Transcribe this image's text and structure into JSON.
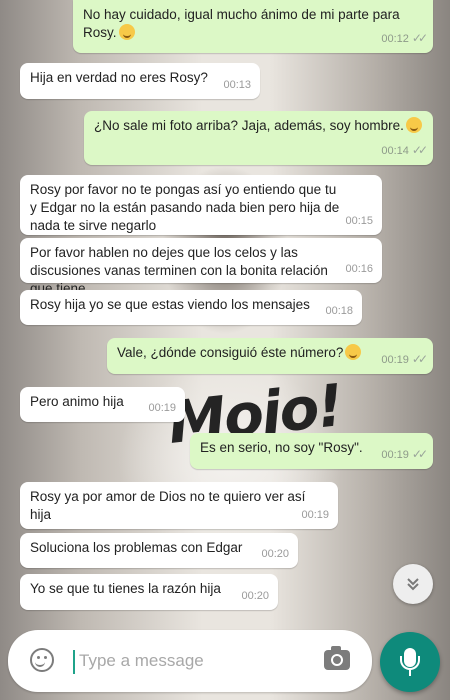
{
  "messages": [
    {
      "dir": "out",
      "text": "No hay cuidado, igual mucho ánimo de mi parte para Rosy.",
      "emoji": "smiling-face",
      "time": "00:12",
      "ticks": "✓✓"
    },
    {
      "dir": "in",
      "text": "Hija en verdad no eres Rosy?",
      "time": "00:13"
    },
    {
      "dir": "out",
      "text": "¿No sale mi foto arriba? Jaja, además, soy hombre.",
      "emoji": "laughing-face",
      "time": "00:14",
      "ticks": "✓✓"
    },
    {
      "dir": "in",
      "text": "Rosy por favor no te pongas así yo entiendo que tu y Edgar no la están pasando nada bien pero hija de nada te sirve negarlo",
      "time": "00:15"
    },
    {
      "dir": "in",
      "text": "Por favor hablen no dejes que los celos y las discusiones vanas terminen  con la bonita relación que tiene",
      "time": "00:16"
    },
    {
      "dir": "in",
      "text": "Rosy hija yo se que estas viendo los mensajes",
      "time": "00:18"
    },
    {
      "dir": "out",
      "text": "Vale, ¿dónde consiguió éste número?",
      "emoji": "crying-face",
      "time": "00:19",
      "ticks": "✓✓"
    },
    {
      "dir": "in",
      "text": "Pero animo hija",
      "time": "00:19"
    },
    {
      "dir": "out",
      "text": "Es en serio, no soy \"Rosy\".",
      "time": "00:19",
      "ticks": "✓✓"
    },
    {
      "dir": "in",
      "text": "Rosy ya por amor de Dios no te quiero ver así hija",
      "time": "00:19"
    },
    {
      "dir": "in",
      "text": "Soluciona los problemas con Edgar",
      "time": "00:20"
    },
    {
      "dir": "in",
      "text": "Yo se que tu tienes la razón hija",
      "time": "00:20"
    }
  ],
  "wallpaper_text": "Mojo!",
  "input": {
    "placeholder": "Type a message",
    "value": ""
  },
  "icons": {
    "emoji_button": "emoji-icon",
    "camera_button": "camera-icon",
    "mic_button": "mic-icon",
    "scroll_down": "double-chevron-down-icon"
  },
  "colors": {
    "outgoing_bubble": "#dcf8c6",
    "incoming_bubble": "#ffffff",
    "accent": "#0e8a7b"
  }
}
